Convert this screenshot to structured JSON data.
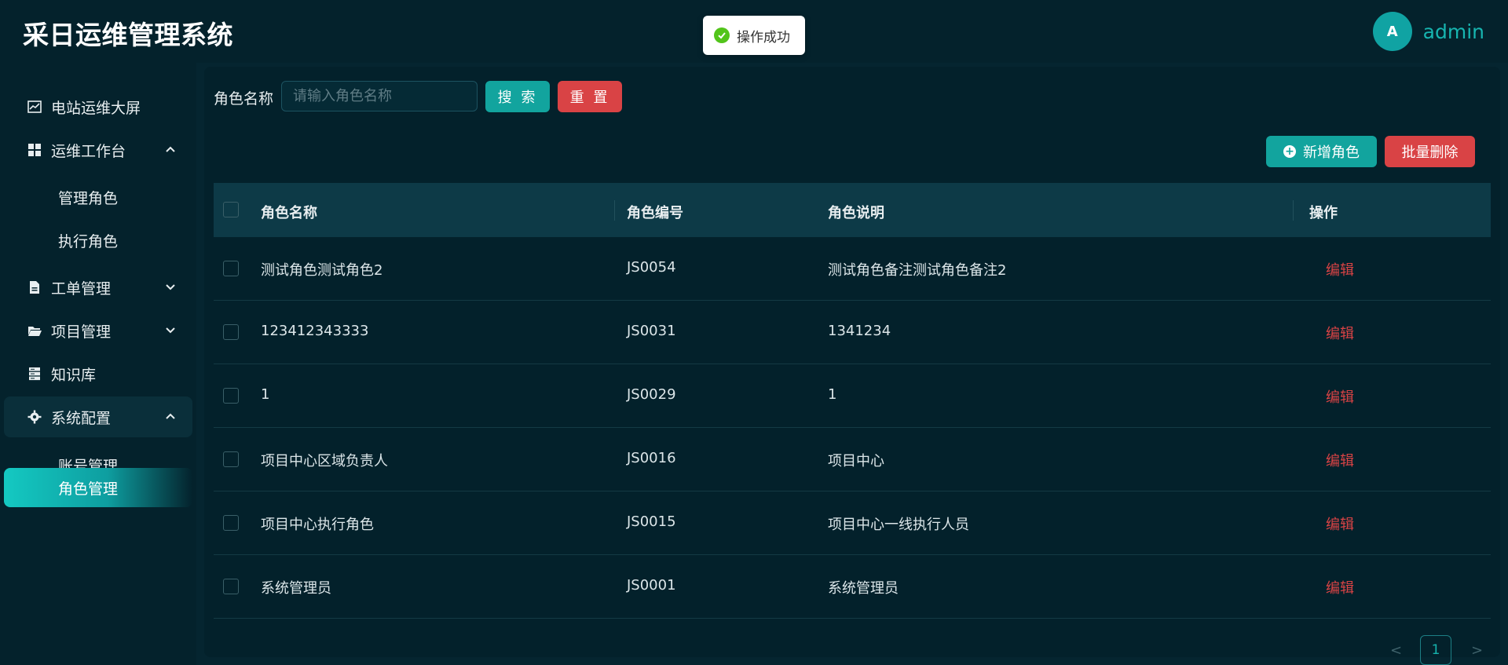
{
  "app": {
    "title": "采日运维管理系统",
    "user": {
      "avatar_letter": "A",
      "name": "admin"
    }
  },
  "toast": {
    "text": "操作成功",
    "icon": "check-circle-icon",
    "status_color": "#52c41a"
  },
  "sidebar": {
    "items": [
      {
        "label": "电站运维大屏",
        "icon": "chart-line-icon"
      },
      {
        "label": "运维工作台",
        "icon": "dashboard-grid-icon",
        "expanded": true
      },
      {
        "label": "管理角色"
      },
      {
        "label": "执行角色"
      },
      {
        "label": "工单管理",
        "icon": "file-icon",
        "expanded": false
      },
      {
        "label": "项目管理",
        "icon": "folder-open-icon",
        "expanded": false
      },
      {
        "label": "知识库",
        "icon": "server-icon"
      },
      {
        "label": "系统配置",
        "icon": "gear-icon",
        "expanded": true
      },
      {
        "label": "账号管理"
      },
      {
        "label": "角色管理",
        "active": true
      }
    ]
  },
  "search": {
    "label": "角色名称",
    "placeholder": "请输入角色名称",
    "search_button": "搜 索",
    "reset_button": "重 置"
  },
  "toolbar": {
    "add_button": "新增角色",
    "batch_delete_button": "批量删除"
  },
  "table": {
    "columns": [
      "角色名称",
      "角色编号",
      "角色说明",
      "操作"
    ],
    "rows": [
      {
        "name": "测试角色测试角色2",
        "code": "JS0054",
        "desc": "测试角色备注测试角色备注2",
        "action": "编辑"
      },
      {
        "name": "123412343333",
        "code": "JS0031",
        "desc": "1341234",
        "action": "编辑"
      },
      {
        "name": "1",
        "code": "JS0029",
        "desc": "1",
        "action": "编辑"
      },
      {
        "name": "项目中心区域负责人",
        "code": "JS0016",
        "desc": "项目中心",
        "action": "编辑"
      },
      {
        "name": "项目中心执行角色",
        "code": "JS0015",
        "desc": "项目中心一线执行人员",
        "action": "编辑"
      },
      {
        "name": "系统管理员",
        "code": "JS0001",
        "desc": "系统管理员",
        "action": "编辑"
      }
    ]
  },
  "pagination": {
    "prev": "<",
    "current": "1",
    "next": ">"
  },
  "colors": {
    "accent": "#12a49e",
    "danger": "#d94345",
    "background": "#04222c"
  }
}
